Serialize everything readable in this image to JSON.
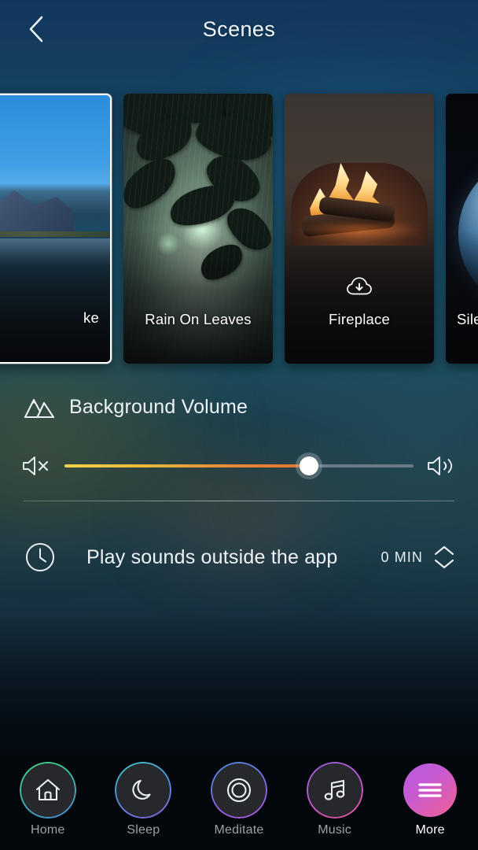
{
  "header": {
    "title": "Scenes",
    "back_icon": "chevron-left-icon"
  },
  "carousel": {
    "scenes": [
      {
        "name": "Lake",
        "visible_label": "ke",
        "selected": true,
        "needs_download": false,
        "art": "lake"
      },
      {
        "name": "Rain On Leaves",
        "visible_label": "Rain On Leaves",
        "selected": false,
        "needs_download": false,
        "art": "rain"
      },
      {
        "name": "Fireplace",
        "visible_label": "Fireplace",
        "selected": false,
        "needs_download": true,
        "art": "fire"
      },
      {
        "name": "Silent Earth",
        "visible_label": "Silent Ear",
        "selected": false,
        "needs_download": true,
        "art": "earth"
      }
    ],
    "download_icon": "cloud-download-icon"
  },
  "background_volume": {
    "label": "Background Volume",
    "scene_icon": "mountains-icon",
    "mute_icon": "volume-mute-icon",
    "loud_icon": "volume-up-icon",
    "value_percent": 70
  },
  "outside_app": {
    "label": "Play sounds outside the app",
    "clock_icon": "clock-icon",
    "value": "0 MIN",
    "stepper_up_icon": "chevron-up-icon",
    "stepper_down_icon": "chevron-down-icon"
  },
  "tabbar": {
    "items": [
      {
        "label": "Home",
        "icon": "home-icon",
        "active": false
      },
      {
        "label": "Sleep",
        "icon": "moon-icon",
        "active": false
      },
      {
        "label": "Meditate",
        "icon": "circles-icon",
        "active": false
      },
      {
        "label": "Music",
        "icon": "music-note-icon",
        "active": false
      },
      {
        "label": "More",
        "icon": "hamburger-icon",
        "active": true
      }
    ]
  },
  "colors": {
    "accent_start": "#f2d24a",
    "accent_end": "#e2702f",
    "more_gradient_start": "#b45ce0",
    "more_gradient_end": "#ef5f93",
    "background_top": "#12375c",
    "background_bottom": "#02060a"
  }
}
